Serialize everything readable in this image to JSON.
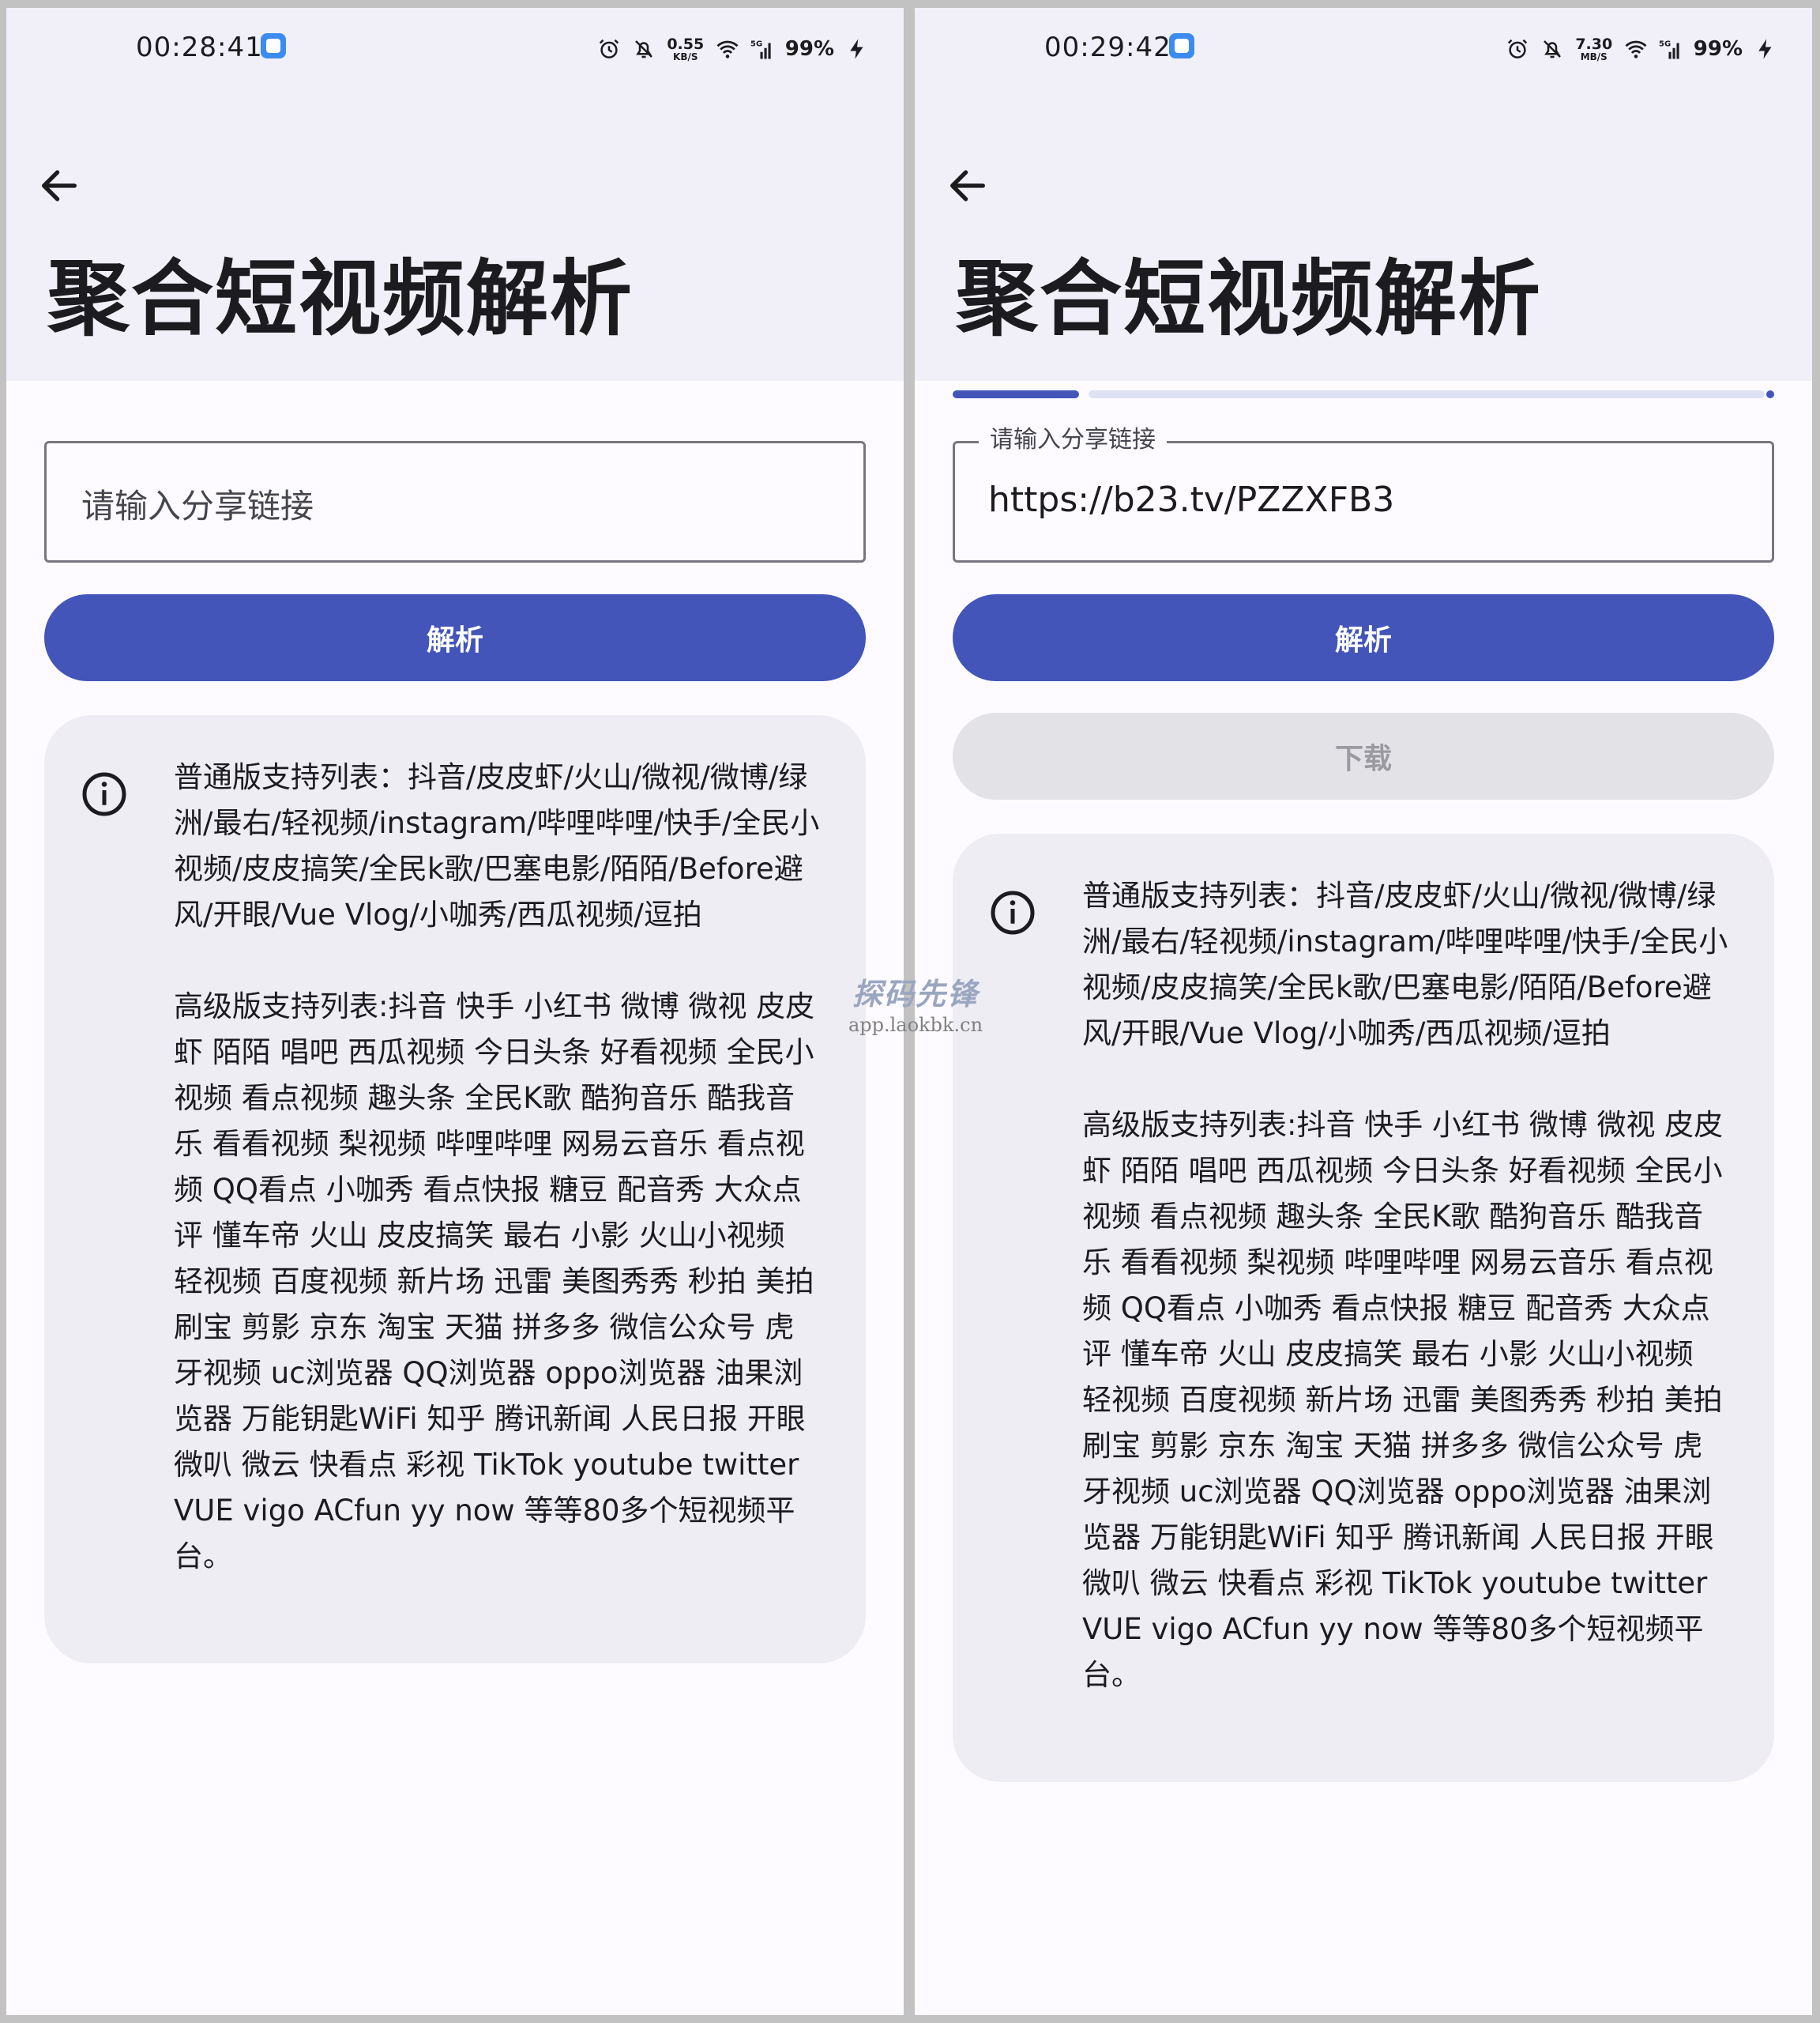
{
  "screens": {
    "left": {
      "status": {
        "time": "00:28:41",
        "net_speed": "0.55",
        "net_unit": "KB/S",
        "battery": "99%"
      },
      "title": "聚合短视频解析",
      "input": {
        "placeholder": "请输入分享链接"
      },
      "parse_button": "解析",
      "info": {
        "basic": "普通版支持列表：抖音/皮皮虾/火山/微视/微博/绿洲/最右/轻视频/instagram/哔哩哔哩/快手/全民小视频/皮皮搞笑/全民k歌/巴塞电影/陌陌/Before避风/开眼/Vue Vlog/小咖秀/西瓜视频/逗拍",
        "advanced": "高级版支持列表:抖音 快手 小红书 微博 微视 皮皮虾 陌陌 唱吧 西瓜视频 今日头条 好看视频 全民小视频 看点视频 趣头条 全民K歌 酷狗音乐 酷我音乐 看看视频 梨视频 哔哩哔哩 网易云音乐 看点视频 QQ看点 小咖秀 看点快报 糖豆 配音秀 大众点评 懂车帝 火山 皮皮搞笑 最右 小影 火山小视频 轻视频 百度视频 新片场 迅雷 美图秀秀 秒拍 美拍 刷宝 剪影 京东 淘宝 天猫 拼多多 微信公众号 虎牙视频 uc浏览器 QQ浏览器 oppo浏览器 油果浏览器 万能钥匙WiFi 知乎 腾讯新闻 人民日报 开眼 微叭 微云 快看点 彩视 TikTok youtube twitter VUE vigo ACfun yy now 等等80多个短视频平台。"
      }
    },
    "right": {
      "status": {
        "time": "00:29:42",
        "net_speed": "7.30",
        "net_unit": "MB/S",
        "battery": "99%"
      },
      "title": "聚合短视频解析",
      "progress_state": "indeterminate",
      "input": {
        "label": "请输入分享链接",
        "value": "https://b23.tv/PZZXFB3"
      },
      "parse_button": "解析",
      "download_button": "下载",
      "info": {
        "basic": "普通版支持列表：抖音/皮皮虾/火山/微视/微博/绿洲/最右/轻视频/instagram/哔哩哔哩/快手/全民小视频/皮皮搞笑/全民k歌/巴塞电影/陌陌/Before避风/开眼/Vue Vlog/小咖秀/西瓜视频/逗拍",
        "advanced": "高级版支持列表:抖音 快手 小红书 微博 微视 皮皮虾 陌陌 唱吧 西瓜视频 今日头条 好看视频 全民小视频 看点视频 趣头条 全民K歌 酷狗音乐 酷我音乐 看看视频 梨视频 哔哩哔哩 网易云音乐 看点视频 QQ看点 小咖秀 看点快报 糖豆 配音秀 大众点评 懂车帝 火山 皮皮搞笑 最右 小影 火山小视频 轻视频 百度视频 新片场 迅雷 美图秀秀 秒拍 美拍 刷宝 剪影 京东 淘宝 天猫 拼多多 微信公众号 虎牙视频 uc浏览器 QQ浏览器 oppo浏览器 油果浏览器 万能钥匙WiFi 知乎 腾讯新闻 人民日报 开眼 微叭 微云 快看点 彩视 TikTok youtube twitter VUE vigo ACfun yy now 等等80多个短视频平台。"
      }
    }
  },
  "watermark": {
    "title": "探码先锋",
    "url": "app.laokbk.cn"
  },
  "icons": {
    "back": "back-arrow-icon",
    "info": "info-circle-icon",
    "alarm": "alarm-icon",
    "mute": "bell-off-icon",
    "wifi": "wifi-icon",
    "signal": "cellular-5g-icon",
    "charging": "charging-bolt-icon"
  },
  "colors": {
    "primary": "#4355b9",
    "header_bg": "#f1eff7",
    "surface": "#fdfbff",
    "card_bg": "#efedf4",
    "disabled_bg": "#e3e2e6"
  }
}
